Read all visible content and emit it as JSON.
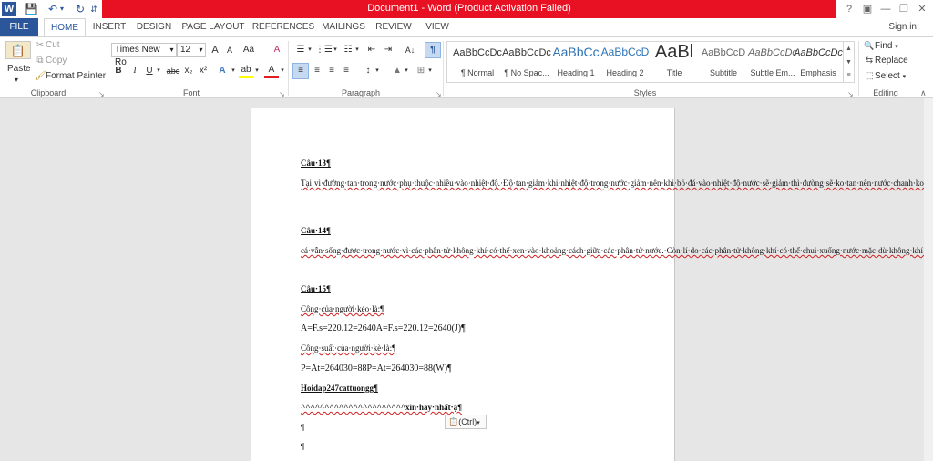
{
  "window": {
    "title": "Document1 - Word (Product Activation Failed)",
    "help_icon": "?",
    "ribbon_display_icon": "▣",
    "minimize_icon": "—",
    "restore_icon": "❐",
    "close_icon": "✕"
  },
  "quick_access": {
    "word_icon": "W",
    "save_icon": "💾",
    "undo_icon": "↶",
    "undo_arrow": "▾",
    "redo_icon": "↻",
    "customize_icon": "⇵"
  },
  "tabs": [
    "FILE",
    "HOME",
    "INSERT",
    "DESIGN",
    "PAGE LAYOUT",
    "REFERENCES",
    "MAILINGS",
    "REVIEW",
    "VIEW"
  ],
  "active_tab": "HOME",
  "signin": "Sign in",
  "clipboard": {
    "paste": "Paste",
    "paste_arrow": "▾",
    "cut": "Cut",
    "copy": "Copy",
    "format_painter": "Format Painter",
    "label": "Clipboard"
  },
  "font": {
    "name": "Times New Ro",
    "size": "12",
    "label": "Font",
    "grow": "A",
    "shrink": "A",
    "case": "Aa",
    "clear": "A",
    "bold": "B",
    "italic": "I",
    "underline": "U",
    "strike": "abc",
    "subscript": "x₂",
    "superscript": "x²",
    "effects": "A",
    "highlight": "ab",
    "color": "A",
    "dropdown_arrow": "▾"
  },
  "paragraph": {
    "label": "Paragraph",
    "bullets": "☰",
    "numbering": "⋮☰",
    "multilevel": "☷",
    "decrease_indent": "⇤",
    "increase_indent": "⇥",
    "sort": "A↓",
    "show_marks": "¶",
    "align_left": "≡",
    "align_center": "≡",
    "align_right": "≡",
    "justify": "≡",
    "spacing": "↕",
    "shading": "▲",
    "borders": "⊞",
    "dropdown_arrow": "▾"
  },
  "styles": {
    "label": "Styles",
    "items": [
      {
        "preview": "AaBbCcDc",
        "name": "¶ Normal"
      },
      {
        "preview": "AaBbCcDc",
        "name": "¶ No Spac..."
      },
      {
        "preview": "AaBbCc",
        "name": "Heading 1"
      },
      {
        "preview": "AaBbCcD",
        "name": "Heading 2"
      },
      {
        "preview": "AaBl",
        "name": "Title"
      },
      {
        "preview": "AaBbCcD",
        "name": "Subtitle"
      },
      {
        "preview": "AaBbCcDc",
        "name": "Subtle Em..."
      },
      {
        "preview": "AaBbCcDc",
        "name": "Emphasis"
      }
    ],
    "scroll_up": "▲",
    "scroll_down": "▼",
    "more": "≡"
  },
  "editing": {
    "label": "Editing",
    "find": "Find",
    "replace": "Replace",
    "select": "Select",
    "find_icon": "🔍",
    "replace_icon": "⇆",
    "select_icon": "⬚",
    "dropdown_arrow": "▾"
  },
  "ribbon_collapse_icon": "∧",
  "launcher_icon": "↘",
  "document": {
    "paragraphs": [
      "Câu·13¶",
      "Tại·vì·đường·tan·trong·nước·phụ·thuộc·nhiều·vào·nhiệt·độ.·Độ·tan·giảm·khi·nhiệt·độ·trong·nước·giảm·nên·khi·bỏ·đá·vào·nhiệt·độ·nước·sẽ·giảm·thì·đường·sẽ·ko·tan·nên·nước·chanh·ko·đủ·ngọt.·Thế·nên·khi·pha·nước·chanh·người·ta·bỏ·đường·vào·nước·khuấy·cho·đường·tan·rồi·mới·bỏ·đá·vào¶",
      "Câu·14¶",
      "cá·vẫn·sống·được·trong·nước·vì·các·phân·tử·không·khí·có·thể·xen·vào·khoảng·cách·giữa·các·phân·tử·nước.·Còn·lí·do·các·phân·tử·không·khí·có·thể·chui·xuống·nước·mặc·dù·không·khí·nhẹ·hơn·nước·thì·sẽ·được·học·ở·bài·sau·về·chuyển·động·phân·tử.¶",
      "Câu·15¶",
      "Công·của·người·kéo·là:¶",
      "A=F.s=220.12=2640A=F.s=220.12=2640(J)¶",
      "Công·suất·của·người·kè·là:¶",
      "P=At=264030=88P=At=264030=88(W)¶",
      "Hoidap247cattuongg¶",
      "^^^^^^^^^^^^^^^^^^^^^^xin·hay·nhất·ạ¶",
      "¶",
      "¶"
    ],
    "paste_options": "(Ctrl)",
    "paste_options_icon": "📋"
  }
}
